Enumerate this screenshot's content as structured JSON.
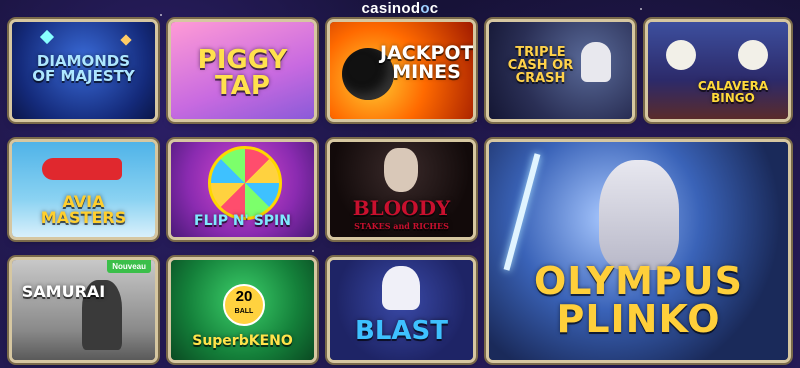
{
  "brand": {
    "name_part1": "casinod",
    "name_part2": "c"
  },
  "games": [
    {
      "title": "DIAMONDS\nOF MAJESTY"
    },
    {
      "title": "PIGGY\nTAP"
    },
    {
      "title": "JACKPOT\nMINES"
    },
    {
      "title": "TRIPLE\nCASH OR\nCRASH"
    },
    {
      "title": "CALAVERA\nBINGO"
    },
    {
      "title": "AVIA\nMASTERS"
    },
    {
      "title": "FLIP N' SPIN"
    },
    {
      "title": "BLOODY",
      "subtitle": "STAKES and RICHES"
    },
    {
      "title": "OLYMPUS\nPLINKO"
    },
    {
      "title": "SAMURAI",
      "badge": "Nouveau"
    },
    {
      "title": "SuperbKENO",
      "ball_number": "20",
      "ball_label": "BALL"
    },
    {
      "title": "BLAST"
    }
  ]
}
